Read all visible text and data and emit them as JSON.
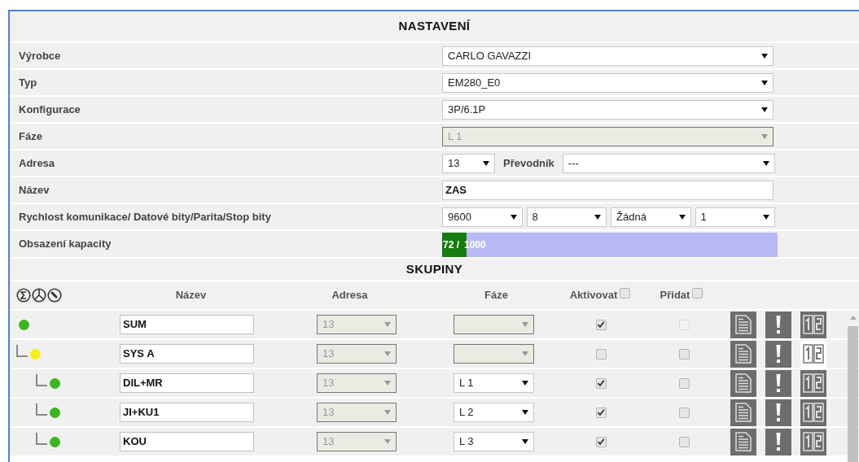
{
  "settings_title": "NASTAVENÍ",
  "settings": [
    {
      "label": "Výrobce",
      "kind": "select",
      "value": "CARLO GAVAZZI",
      "disabled": false
    },
    {
      "label": "Typ",
      "kind": "select",
      "value": "EM280_E0",
      "disabled": false
    },
    {
      "label": "Konfigurace",
      "kind": "select",
      "value": "3P/6.1P",
      "disabled": false
    },
    {
      "label": "Fáze",
      "kind": "select",
      "value": "L 1",
      "disabled": true
    },
    {
      "label": "Adresa",
      "kind": "address",
      "value": "13",
      "converter_label": "Převodník",
      "converter_value": "---"
    },
    {
      "label": "Název",
      "kind": "text",
      "value": "ZAS"
    },
    {
      "label": "Rychlost komunikace/ Datové bity/Parita/Stop bity",
      "kind": "selects",
      "values": [
        "9600",
        "8",
        "Žádná",
        "1"
      ]
    },
    {
      "label": "Obsazení kapacity",
      "kind": "capacity",
      "used": "72 /",
      "total": "1000",
      "level": 0.072
    }
  ],
  "groups_title": "SKUPINY",
  "columns": [
    {
      "label": "Název",
      "kind": "text"
    },
    {
      "label": "Adresa",
      "kind": "text"
    },
    {
      "label": "Fáze",
      "kind": "text"
    },
    {
      "label": "Aktivovat",
      "kind": "checkbox",
      "checked": false
    },
    {
      "label": "Přidat",
      "kind": "checkbox",
      "checked": false
    }
  ],
  "groups": [
    {
      "name": "SUM",
      "color": "#3cb521",
      "address": "13",
      "phase_disabled": true,
      "active": true,
      "add_disabled": true,
      "split_on": true,
      "children": [
        {
          "name": "SYS A",
          "color": "#f5f01a",
          "address": "13",
          "phase_disabled": true,
          "active": false,
          "add_disabled": false,
          "split_on": false,
          "children": [
            {
              "name": "DIL+MR",
              "color": "#3cb521",
              "address": "13",
              "phase": "L 1",
              "phase_disabled": false,
              "active": true,
              "add_disabled": false,
              "split_on": true
            },
            {
              "name": "JI+KU1",
              "color": "#3cb521",
              "address": "13",
              "phase": "L 2",
              "phase_disabled": false,
              "active": true,
              "add_disabled": false,
              "split_on": true
            },
            {
              "name": "KOU",
              "color": "#3cb521",
              "address": "13",
              "phase": "L 3",
              "phase_disabled": false,
              "active": true,
              "add_disabled": false,
              "split_on": true
            }
          ]
        }
      ]
    }
  ]
}
